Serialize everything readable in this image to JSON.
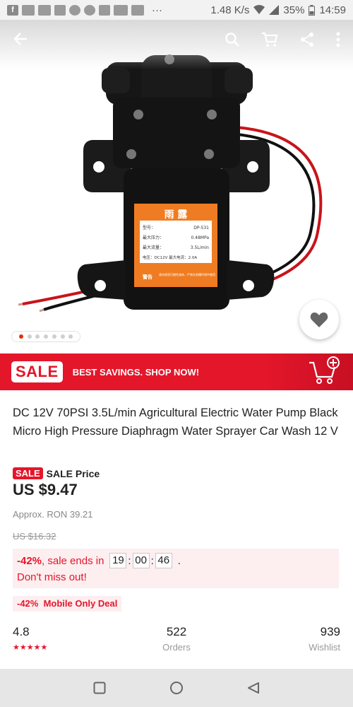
{
  "status_bar": {
    "speed": "1.48 K/s",
    "battery": "35%",
    "time": "14:59",
    "dots": "···"
  },
  "topbar": {
    "back_icon": "arrow-left-icon",
    "search_icon": "search-icon",
    "cart_icon": "cart-icon",
    "share_icon": "share-icon",
    "more_icon": "more-vert-icon"
  },
  "product_image": {
    "label_brand": "雨 露",
    "label_lines": [
      "型号：",
      "DP-531",
      "最大压力：",
      "0.48MPa",
      "最大流量：",
      "3.5L/min",
      "电压：DC12V 最大电流：2.0A"
    ],
    "warning": "警告",
    "warning_text": "请勿喷洒可燃性液体，严禁在易爆环境中使用"
  },
  "carousel": {
    "count": 7,
    "active": 0
  },
  "banner": {
    "sale": "SALE",
    "text": "BEST SAVINGS. SHOP NOW!"
  },
  "product": {
    "title": "DC 12V 70PSI 3.5L/min Agricultural Electric Water Pump Black Micro High Pressure Diaphragm Water Sprayer Car Wash 12 V",
    "sale_badge": "SALE",
    "price_label": "SALE Price",
    "price": "US $9.47",
    "approx": "Approx. RON 39.21",
    "original_price": "US $16.32",
    "discount": "-42%",
    "sale_ends": ", sale ends in",
    "timer": {
      "h": "19",
      "m": "00",
      "s": "46"
    },
    "period": ".",
    "dont_miss": "Don't miss out!",
    "mobile_deal": "-42%  Mobile Only Deal"
  },
  "stats": {
    "rating": "4.8",
    "stars": "★★★★★",
    "orders_count": "522",
    "orders_label": "Orders",
    "wishlist_count": "939",
    "wishlist_label": "Wishlist"
  },
  "colors": {
    "accent": "#e4162a",
    "deal_bg": "#fdeef0"
  }
}
